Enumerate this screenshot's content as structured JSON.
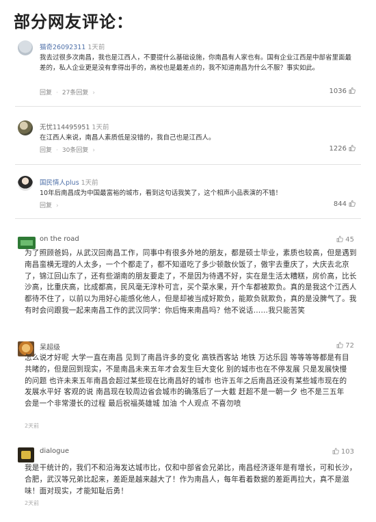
{
  "page_title": "部分网友评论：",
  "comments": [
    {
      "user": "猫奇26092311",
      "time": "1天前",
      "text": "我去过很多次南昌，我也是江西人，不要提什么基础设施，你南昌有人家也有。国有企业江西是中部省里面最差的，私人企业更是没有拿得出手的，高校也是最差点的，我不知道南昌为什么不服？事实如此。",
      "reply_label": "回复",
      "replies": "27条回复",
      "likes": "1036"
    },
    {
      "user": "无忧114495951",
      "time": "1天前",
      "text": "在江西人来说，南昌人素质低是没错的，我自己也是江西人。",
      "reply_label": "回复",
      "replies": "30条回复",
      "likes": "1226"
    },
    {
      "user": "国民情人plus",
      "time": "1天前",
      "text": "10年后南昌成为中国最富裕的城市，看到这句话我笑了，这个相声小品表演的不错！",
      "reply_label": "回复",
      "likes": "844"
    },
    {
      "user": "on the road",
      "text": "为了照顾爸妈，从武汉回南昌工作，同事中有很多外地的朋友，都是硕士毕业，素质也较高，但是遇到南昌蛮横无理的人太多，一个个都走了，都不知道吃了多少顿散伙饭了，傲宇去重庆了，大庆去北京了，锦江回山东了，还有些湖南的朋友要走了，不是因为待遇不好，实在是生活太糟糕，房价高，比长沙高，比重庆高，比成都高，民风毫无淳朴可言，买个菜水果，开个车都被欺负。真的是我这个江西人都待不住了，以前以为用好心能感化他人，但是却被当成好欺负，能欺负就欺负，真的是没脾气了。我有时会问跟我一起来南昌工作的武汉同学：你后悔来南昌吗？他不说话……我只能苦笑",
      "likes": "45"
    },
    {
      "user": "呆超级",
      "text": "怎么说才好呢 大学一直在南昌 见到了南昌许多的变化 高铁西客站 地铁 万达乐园 等等等等都是有目共睹的，但是回到现实，不是南昌未来五年才会发生巨大变化 别的城市也在不停发展 只是发展快慢的问题 也许未来五年南昌会超过某些现在比南昌好的城市 也许五年之后南昌还没有某些城市现在的发展水平好 客观的说 南昌现在较周边省会城市的确落后了一大截 赶超不是一朝一夕 也不是三五年 会是一个非常漫长的过程 最后祝福英雄城 加油 个人观点 不喜勿喷",
      "meta": "2天前",
      "likes": "72"
    },
    {
      "user": "dialogue",
      "text": "我是干统计的，我们不和沿海发达城市比，仅和中部省会兄弟比，南昌经济逐年是有增长，可和长沙，合肥，武汉等兄弟比起来，差距是越来越大了！作为南昌人，每年看着数据的差距再拉大，真不是滋味！面对现实，才能知耻后勇！",
      "meta": "2天前",
      "likes": "103"
    }
  ],
  "icons": {
    "like": "thumbs-up-icon"
  },
  "colors": {
    "username": "#4d6fa8",
    "muted": "#888888",
    "divider": "#e2e2e2"
  }
}
